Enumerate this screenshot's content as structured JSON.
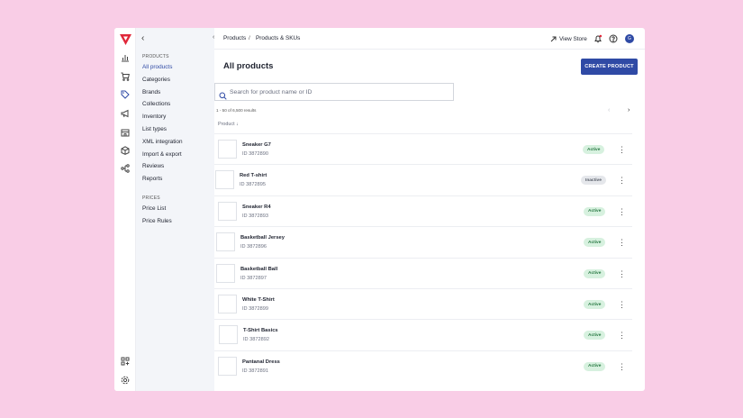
{
  "colors": {
    "accent": "#2f4aa5",
    "logo": "#e0283a",
    "active_bg": "#d7f1df",
    "inactive_bg": "#e5e7eb"
  },
  "rail": {
    "icons": [
      "chart-icon",
      "cart-icon",
      "tag-icon",
      "megaphone-icon",
      "store-icon",
      "box-icon",
      "flow-icon",
      "add-widget-icon",
      "gear-icon"
    ]
  },
  "sidebar": {
    "collapse": "‹",
    "products_section": "PRODUCTS",
    "items": [
      {
        "label": "All products"
      },
      {
        "label": "Categories"
      },
      {
        "label": "Brands"
      },
      {
        "label": "Collections"
      },
      {
        "label": "Inventory"
      },
      {
        "label": "List types"
      },
      {
        "label": "XML integration"
      },
      {
        "label": "Import & export"
      },
      {
        "label": "Reviews"
      },
      {
        "label": "Reports"
      }
    ],
    "prices_section": "PRICES",
    "price_items": [
      {
        "label": "Price List"
      },
      {
        "label": "Price Rules"
      }
    ]
  },
  "header": {
    "back": "‹",
    "breadcrumb": [
      "Products",
      "/",
      "Products & SKUs"
    ],
    "view_store": "View Store",
    "avatar": "G"
  },
  "page": {
    "title": "All products",
    "create_button": "CREATE PRODUCT",
    "search_placeholder": "Search for product name or ID",
    "results": "1 - 50 of 6,500 results",
    "pager_prev": "‹",
    "pager_next": "›",
    "column_product": "Product ↓"
  },
  "products": [
    {
      "name": "Sneaker G7",
      "id": "ID 3872890",
      "status": "Active"
    },
    {
      "name": "Red T-shirt",
      "id": "ID 3872895",
      "status": "Inactive"
    },
    {
      "name": "Sneaker R4",
      "id": "ID 3872893",
      "status": "Active"
    },
    {
      "name": "Basketball Jersey",
      "id": "ID 3872896",
      "status": "Active"
    },
    {
      "name": "Basketball Ball",
      "id": "ID 3872897",
      "status": "Active"
    },
    {
      "name": "White T-Shirt",
      "id": "ID 3872899",
      "status": "Active"
    },
    {
      "name": "T-Shirt Basics",
      "id": "ID 3872892",
      "status": "Active"
    },
    {
      "name": "Pantanal Dress",
      "id": "ID 3872891",
      "status": "Active"
    }
  ]
}
